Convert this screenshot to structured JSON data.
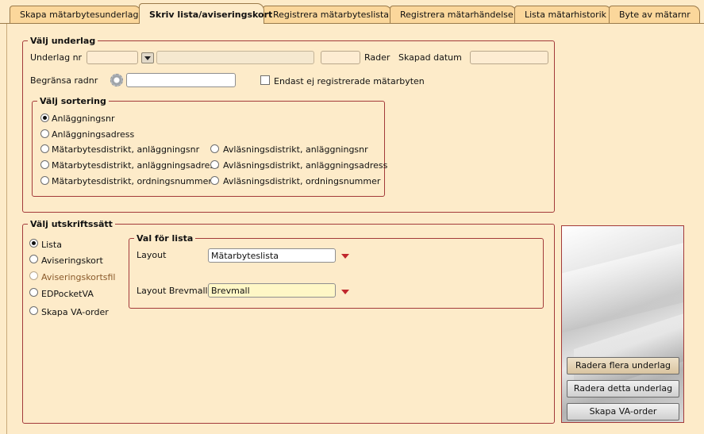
{
  "tabs": [
    {
      "label": "Skapa mätarbytesunderlag",
      "active": false
    },
    {
      "label": "Skriv lista/aviseringskort",
      "active": true
    },
    {
      "label": "Registrera mätarbyteslista",
      "active": false
    },
    {
      "label": "Registrera mätarhändelse",
      "active": false
    },
    {
      "label": "Lista mätarhistorik",
      "active": false
    },
    {
      "label": "Byte av mätarnr",
      "active": false
    }
  ],
  "valj_underlag": {
    "legend": "Välj underlag",
    "underlag_nr_label": "Underlag nr",
    "underlag_nr_value": "",
    "underlag_desc_value": "",
    "rader_value": "",
    "rader_label": "Rader",
    "skapad_datum_label": "Skapad datum",
    "skapad_datum_value": "",
    "begransa_label": "Begränsa radnr",
    "begransa_value": "",
    "endast_label": "Endast ej registrerade mätarbyten",
    "endast_checked": false
  },
  "valj_sortering": {
    "legend": "Välj sortering",
    "selected": "Anläggningsnr",
    "col1": [
      "Anläggningsnr",
      "Anläggningsadress",
      "Mätarbytesdistrikt, anläggningsnr",
      "Mätarbytesdistrikt, anläggningsadress",
      "Mätarbytesdistrikt, ordningsnummer"
    ],
    "col2": [
      "Avläsningsdistrikt, anläggningsnr",
      "Avläsningsdistrikt, anläggningsadress",
      "Avläsningsdistrikt, ordningsnummer"
    ]
  },
  "valj_utskriftssatt": {
    "legend": "Välj utskriftssätt",
    "options": [
      "Lista",
      "Aviseringskort",
      "Aviseringskortsfil",
      "EDPocketVA",
      "Skapa VA-order"
    ],
    "selected": "Lista",
    "disabled": [
      "Aviseringskortsfil"
    ]
  },
  "val_for_lista": {
    "legend": "Val för lista",
    "layout_label": "Layout",
    "layout_value": "Mätarbyteslista",
    "brevmall_label": "Layout Brevmall",
    "brevmall_value": "Brevmall"
  },
  "buttons": {
    "radera_flera": "Radera flera underlag",
    "radera_detta": "Radera detta underlag",
    "skapa_va": "Skapa VA-order"
  },
  "colors": {
    "background": "#fdebc9",
    "tab": "#fbd79b",
    "frame": "#a33a3a",
    "arrow": "#c0272d"
  }
}
